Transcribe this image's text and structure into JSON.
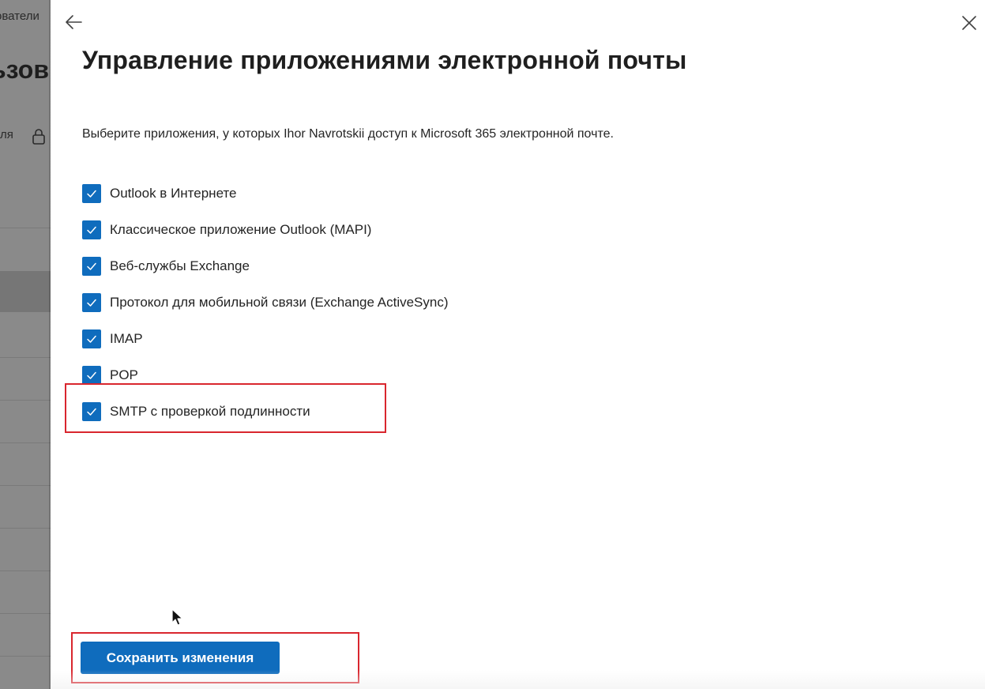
{
  "background_page": {
    "breadcrumb": "ователи",
    "title": "ьзов",
    "filter_label": "ля"
  },
  "panel": {
    "title": "Управление приложениями электронной почты",
    "description": "Выберите приложения, у которых Ihor Navrotskii доступ к Microsoft 365 электронной почте.",
    "apps": [
      {
        "label": "Outlook в Интернете",
        "checked": true
      },
      {
        "label": "Классическое приложение Outlook (MAPI)",
        "checked": true
      },
      {
        "label": "Веб-службы Exchange",
        "checked": true
      },
      {
        "label": "Протокол для мобильной связи (Exchange ActiveSync)",
        "checked": true
      },
      {
        "label": "IMAP",
        "checked": true
      },
      {
        "label": "POP",
        "checked": true
      },
      {
        "label": "SMTP с проверкой подлинности",
        "checked": true
      }
    ],
    "save_label": "Сохранить изменения"
  },
  "icons": {
    "back": "arrow-left-icon",
    "close": "close-icon",
    "lock": "lock-icon",
    "checkmark": "checkmark-icon"
  },
  "colors": {
    "accent": "#0f6cbd",
    "highlight": "#d9262e",
    "overlay": "#8a8a8a"
  }
}
